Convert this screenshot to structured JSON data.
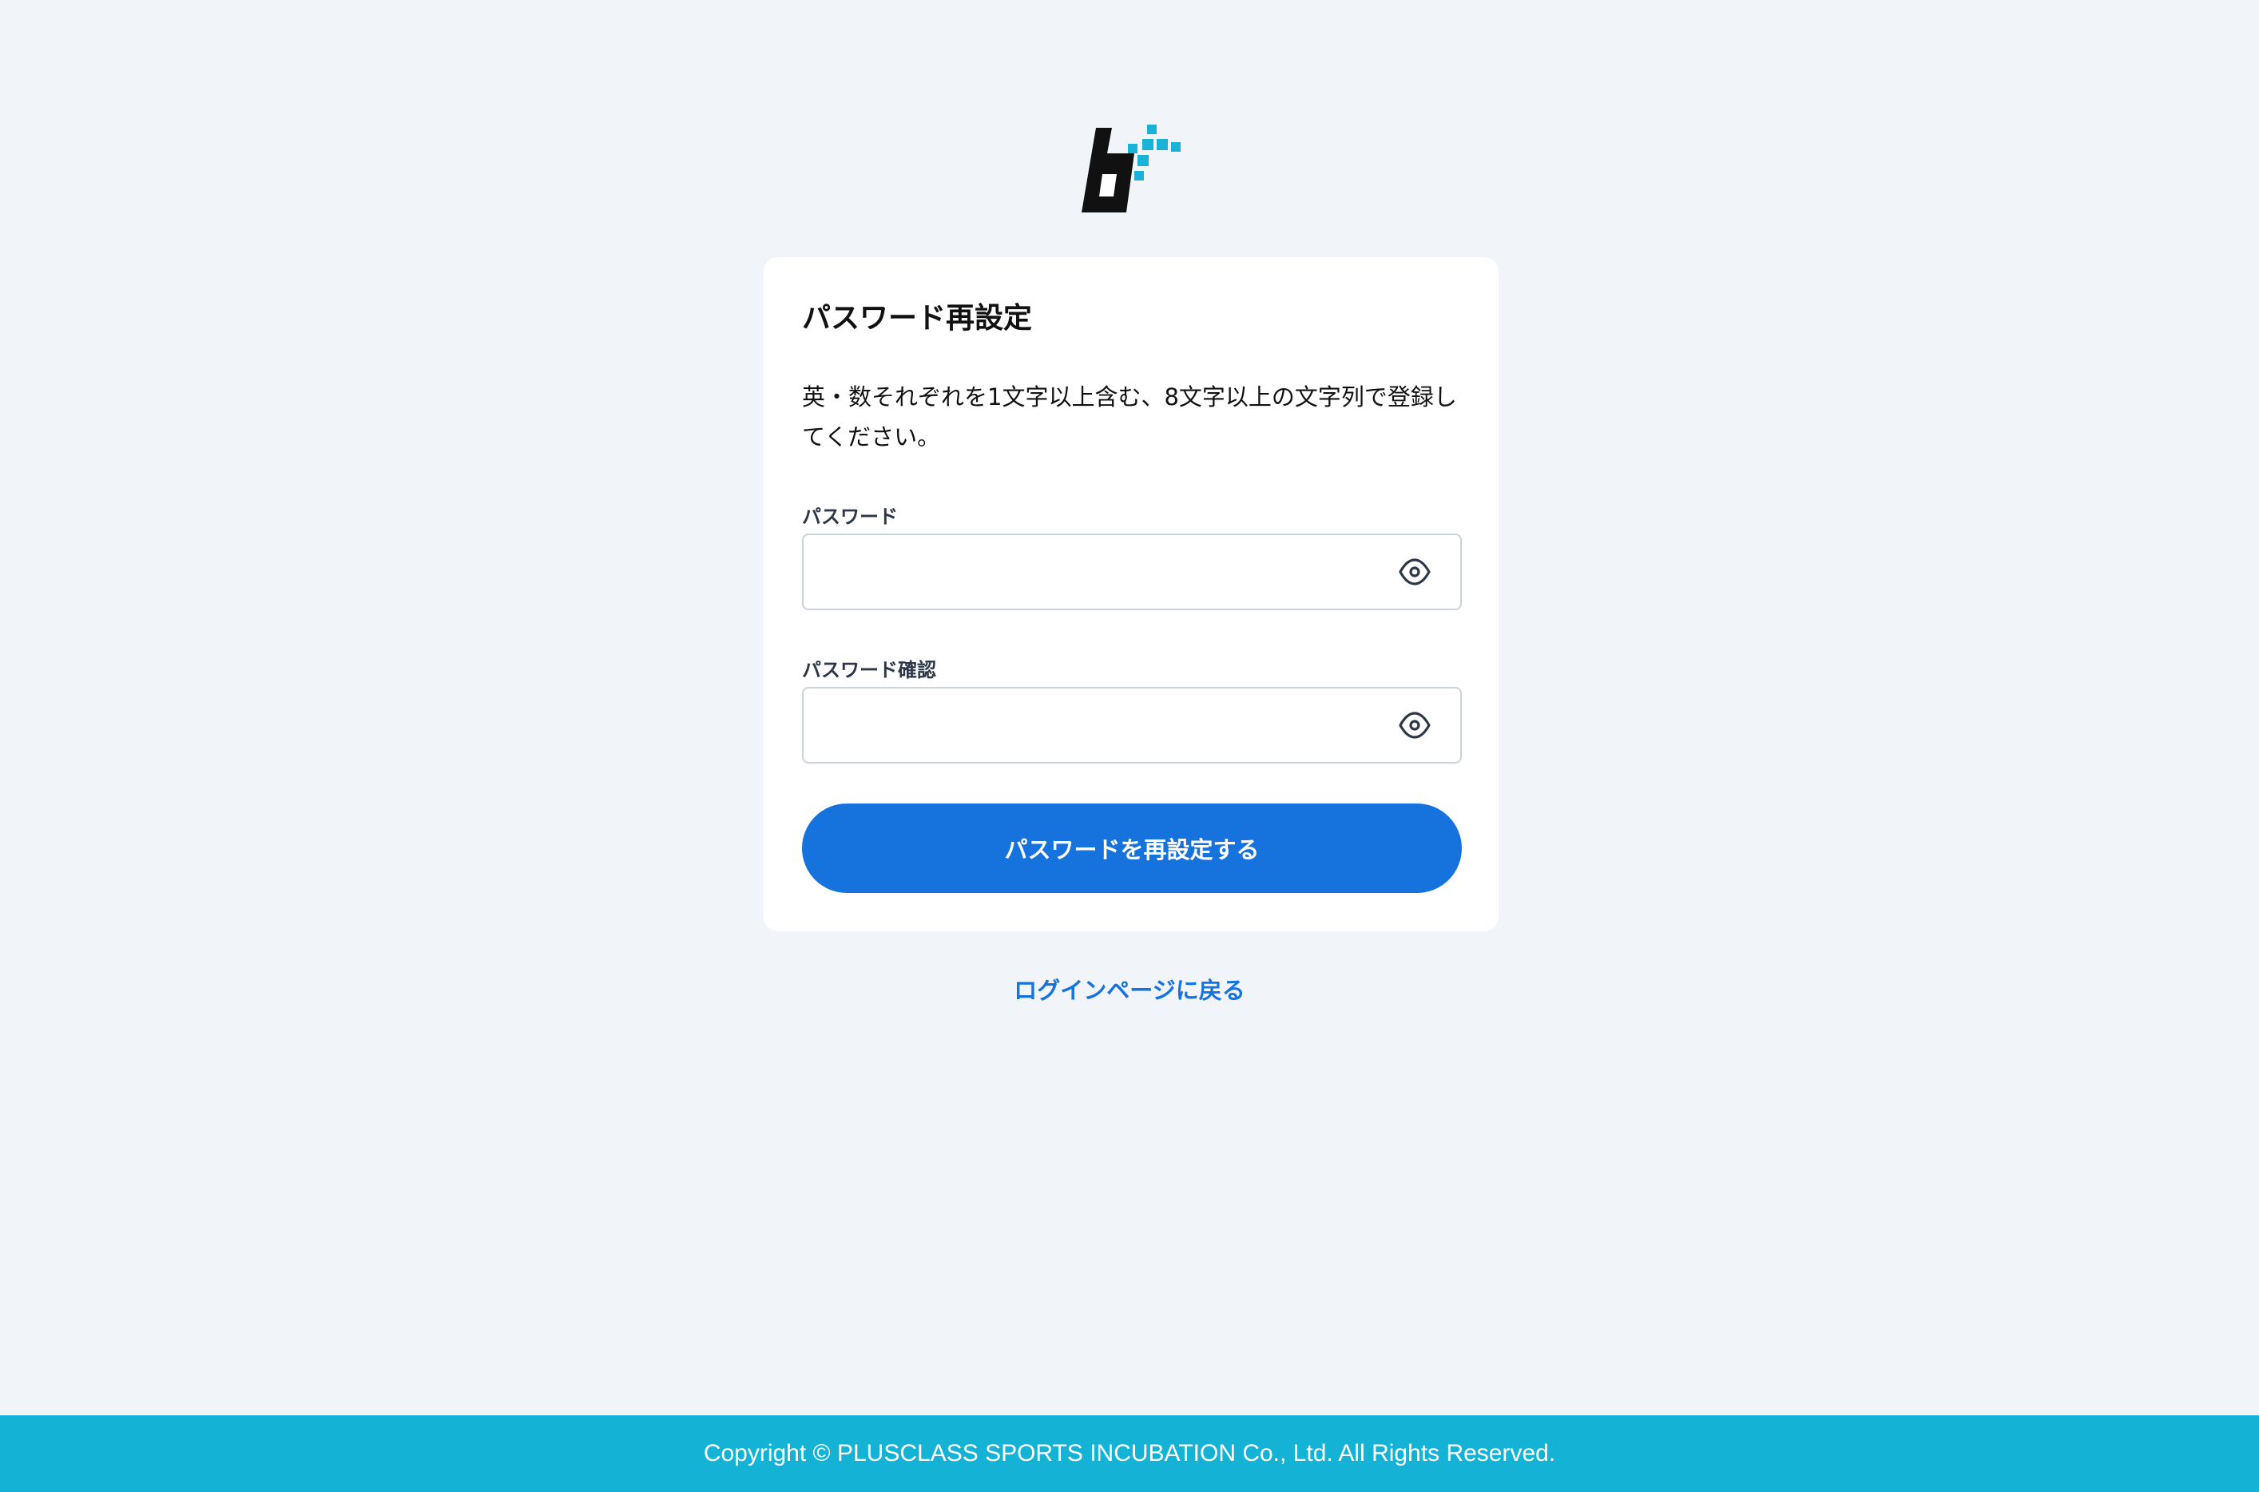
{
  "colors": {
    "background": "#f1f4f9",
    "primary": "#1672dc",
    "footer": "#14b3d6",
    "logo_dark": "#111111",
    "logo_accent": "#19b3d9"
  },
  "logo": {
    "icon": "b-plus-logo"
  },
  "card": {
    "title": "パスワード再設定",
    "description": "英・数それぞれを1文字以上含む、8文字以上の文字列で登録してください。",
    "password": {
      "label": "パスワード",
      "value": "",
      "placeholder": "",
      "toggle_icon": "eye-icon"
    },
    "password_confirm": {
      "label": "パスワード確認",
      "value": "",
      "placeholder": "",
      "toggle_icon": "eye-icon"
    },
    "submit_label": "パスワードを再設定する"
  },
  "back_link": "ログインページに戻る",
  "footer": {
    "copyright": "Copyright © PLUSCLASS SPORTS INCUBATION Co., Ltd. All Rights Reserved."
  }
}
